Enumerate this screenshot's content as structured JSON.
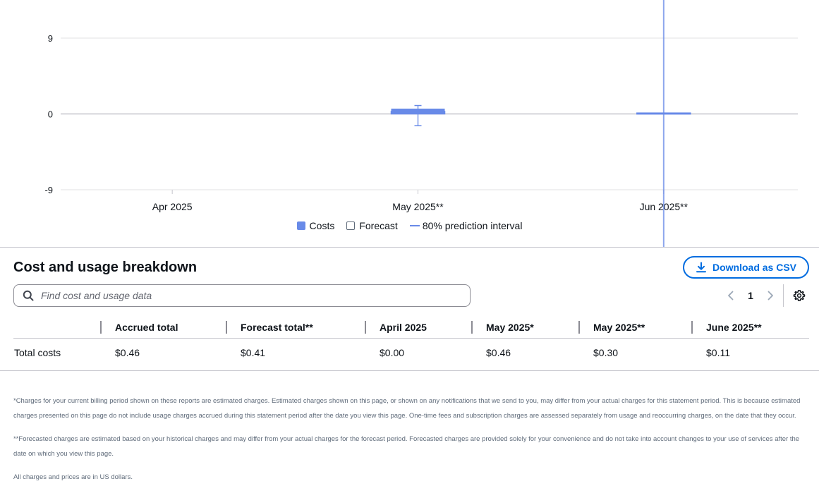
{
  "chart_data": {
    "type": "bar",
    "categories": [
      "Apr 2025",
      "May 2025**",
      "Jun 2025**"
    ],
    "yticks": [
      9,
      0,
      -9
    ],
    "ylim": [
      -9,
      9
    ],
    "series": [
      {
        "name": "Costs",
        "kind": "bar",
        "values": [
          0.0,
          0.46,
          0.0
        ],
        "color": "#688ae8"
      },
      {
        "name": "Forecast",
        "kind": "bar-outline",
        "values": [
          null,
          0.3,
          0.11
        ],
        "color": "#688ae8"
      },
      {
        "name": "80% prediction interval",
        "kind": "interval",
        "lower": [
          null,
          -1.4,
          -10000
        ],
        "upper": [
          null,
          1.0,
          10000
        ],
        "color": "#688ae8"
      }
    ],
    "legend": [
      "Costs",
      "Forecast",
      "80% prediction interval"
    ],
    "legend_position": "bottom-center",
    "grid": true
  },
  "breakdown": {
    "title": "Cost and usage breakdown",
    "download_label": "Download as CSV",
    "search_placeholder": "Find cost and usage data",
    "page_number": "1",
    "columns": [
      "",
      "Accrued total",
      "Forecast total**",
      "April 2025",
      "May 2025*",
      "May 2025**",
      "June 2025**"
    ],
    "rows": [
      [
        "Total costs",
        "$0.46",
        "$0.41",
        "$0.00",
        "$0.46",
        "$0.30",
        "$0.11"
      ]
    ]
  },
  "footnotes": [
    "*Charges for your current billing period shown on these reports are estimated charges. Estimated charges shown on this page, or shown on any notifications that we send to you, may differ from your actual charges for this statement period. This is because estimated charges presented on this page do not include usage charges accrued during this statement period after the date you view this page. One-time fees and subscription charges are assessed separately from usage and reoccurring charges, on the date that they occur.",
    "**Forecasted charges are estimated based on your historical charges and may differ from your actual charges for the forecast period. Forecasted charges are provided solely for your convenience and do not take into account changes to your use of services after the date on which you view this page.",
    "All charges and prices are in US dollars."
  ],
  "colors": {
    "accent": "#006ce0",
    "series": "#688ae8",
    "grid": "#e0e0e3"
  }
}
